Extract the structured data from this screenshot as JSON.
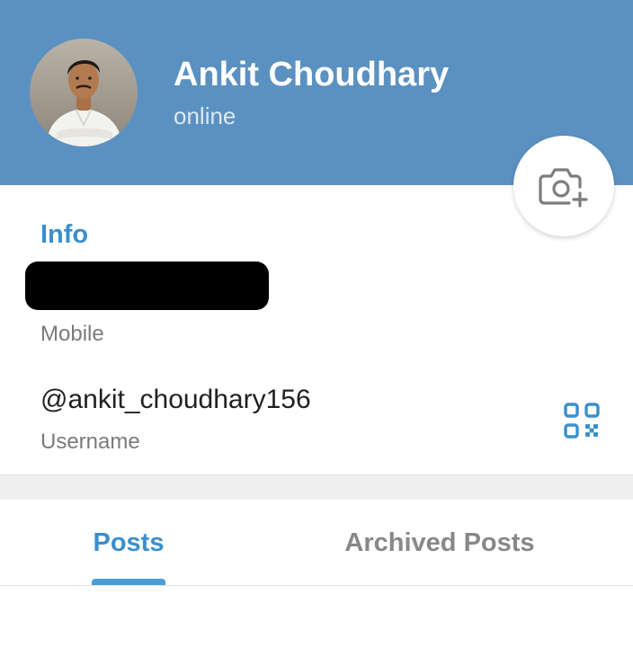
{
  "header": {
    "name": "Ankit Choudhary",
    "status": "online",
    "background_color": "#5b91c1",
    "avatar_icon": "profile-photo",
    "camera_icon": "camera-add-icon"
  },
  "info": {
    "title": "Info",
    "mobile_label": "Mobile",
    "username_value": "@ankit_choudhary156",
    "username_label": "Username",
    "qr_icon": "qr-code-icon"
  },
  "tabs": [
    {
      "label": "Posts",
      "active": true
    },
    {
      "label": "Archived Posts",
      "active": false
    }
  ],
  "colors": {
    "accent": "#3a8fcc",
    "secondary_text": "#7b7b7b"
  }
}
